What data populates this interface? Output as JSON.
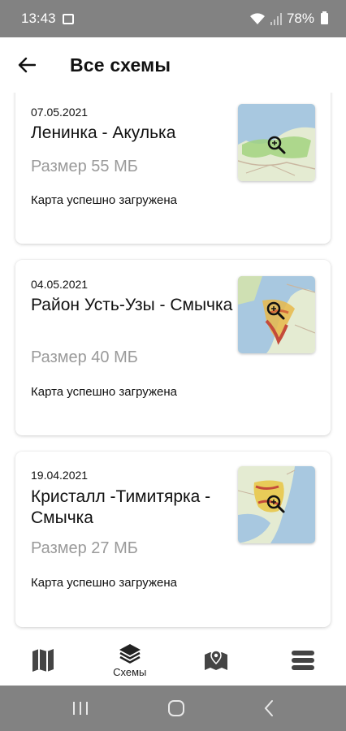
{
  "status_bar": {
    "time": "13:43",
    "battery": "78%"
  },
  "app_bar": {
    "title": "Все схемы"
  },
  "cards": [
    {
      "date": "07.05.2021",
      "name": "Ленинка - Акулька",
      "size": "Размер 55 МБ",
      "status": "Карта успешно загружена"
    },
    {
      "date": "04.05.2021",
      "name": "Район Усть-Узы - Смычка",
      "size": "Размер 40 МБ",
      "status": "Карта успешно загружена"
    },
    {
      "date": "19.04.2021",
      "name": "Кристалл -Тимитярка - Смычка",
      "size": "Размер 27 МБ",
      "status": "Карта успешно загружена"
    }
  ],
  "bottom_nav": [
    {
      "icon": "map-icon",
      "label": ""
    },
    {
      "icon": "layers-icon",
      "label": "Схемы"
    },
    {
      "icon": "map-pin-icon",
      "label": ""
    },
    {
      "icon": "menu-icon",
      "label": ""
    }
  ],
  "colors": {
    "status_bar": "#828282",
    "text": "#111111",
    "muted": "#9a9a9a",
    "water": "#a8c8e0",
    "land": "#e0e8c8"
  }
}
